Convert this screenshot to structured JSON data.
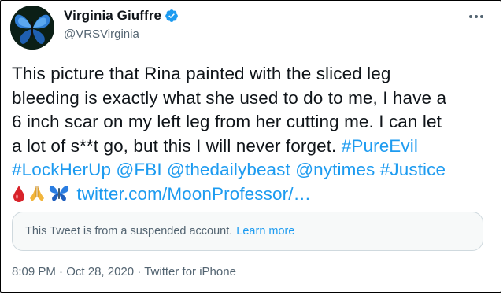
{
  "author": {
    "display_name": "Virginia Giuffre",
    "handle": "@VRSVirginia",
    "avatar_icon": "blue-butterfly-avatar",
    "verified_icon": "verified-badge-icon"
  },
  "tweet": {
    "line1": "This picture that Rina painted with the sliced leg",
    "line2": "bleeding is exactly what she used to do to me, I have a",
    "line3": "6 inch scar on my left leg from her cutting me. I can let",
    "line4_text": "a lot of s**t go, but this I will never forget. ",
    "hashtag_pure_evil": "#PureEvil",
    "hashtag_lock_her_up": "#LockHerUp",
    "mention_fbi": "@FBI",
    "mention_dailybeast": "@thedailybeast",
    "mention_nytimes": "@nytimes",
    "hashtag_justice": "#Justice",
    "emojis": [
      "blood-drop-icon",
      "praying-hands-icon",
      "butterfly-icon"
    ],
    "link": "twitter.com/MoonProfessor/…"
  },
  "notice": {
    "text": "This Tweet is from a suspended account.",
    "learn_more": "Learn more"
  },
  "meta": {
    "time": "8:09 PM",
    "separator1": " · ",
    "date": "Oct 28, 2020",
    "separator2": " · ",
    "source": "Twitter for iPhone"
  },
  "colors": {
    "link": "#1d9bf0",
    "text": "#0f1419",
    "muted": "#536471"
  }
}
